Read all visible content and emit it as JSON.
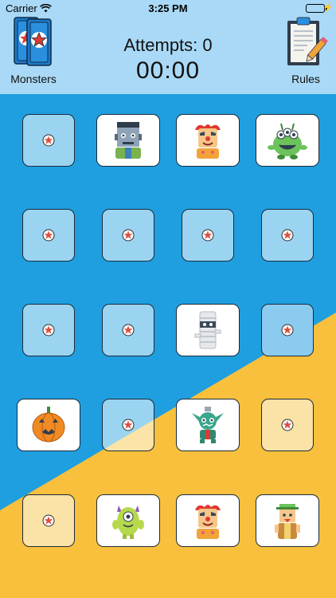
{
  "status_bar": {
    "carrier": "Carrier",
    "time": "3:25 PM"
  },
  "header": {
    "monsters_label": "Monsters",
    "rules_label": "Rules",
    "attempts_text": "Attempts: 0",
    "timer_text": "00:00"
  },
  "colors": {
    "header_bg": "#a9d9f6",
    "board_blue": "#1f9fe0",
    "board_yellow": "#f8c03c",
    "card_border": "#1b2b3a"
  },
  "board": {
    "rows": 5,
    "columns": 4,
    "cards": [
      {
        "state": "hidden",
        "icon": "star-token-icon"
      },
      {
        "state": "revealed",
        "icon": "frankenstein-monster-icon"
      },
      {
        "state": "revealed",
        "icon": "clown-monster-icon"
      },
      {
        "state": "revealed",
        "icon": "three-eyed-alien-monster-icon"
      },
      {
        "state": "hidden",
        "icon": "star-token-icon"
      },
      {
        "state": "hidden",
        "icon": "star-token-icon"
      },
      {
        "state": "hidden",
        "icon": "star-token-icon"
      },
      {
        "state": "hidden",
        "icon": "star-token-icon"
      },
      {
        "state": "hidden",
        "icon": "star-token-icon"
      },
      {
        "state": "hidden",
        "icon": "star-token-icon"
      },
      {
        "state": "revealed",
        "icon": "mummy-monster-icon"
      },
      {
        "state": "hidden",
        "icon": "star-token-icon"
      },
      {
        "state": "revealed",
        "icon": "pumpkin-monster-icon"
      },
      {
        "state": "hidden",
        "icon": "star-token-icon"
      },
      {
        "state": "revealed",
        "icon": "gremlin-monster-icon"
      },
      {
        "state": "hidden",
        "icon": "star-token-icon"
      },
      {
        "state": "hidden",
        "icon": "star-token-icon"
      },
      {
        "state": "revealed",
        "icon": "cyclops-monster-icon"
      },
      {
        "state": "revealed",
        "icon": "clown-monster-icon"
      },
      {
        "state": "revealed",
        "icon": "dwarf-monster-icon"
      }
    ]
  }
}
